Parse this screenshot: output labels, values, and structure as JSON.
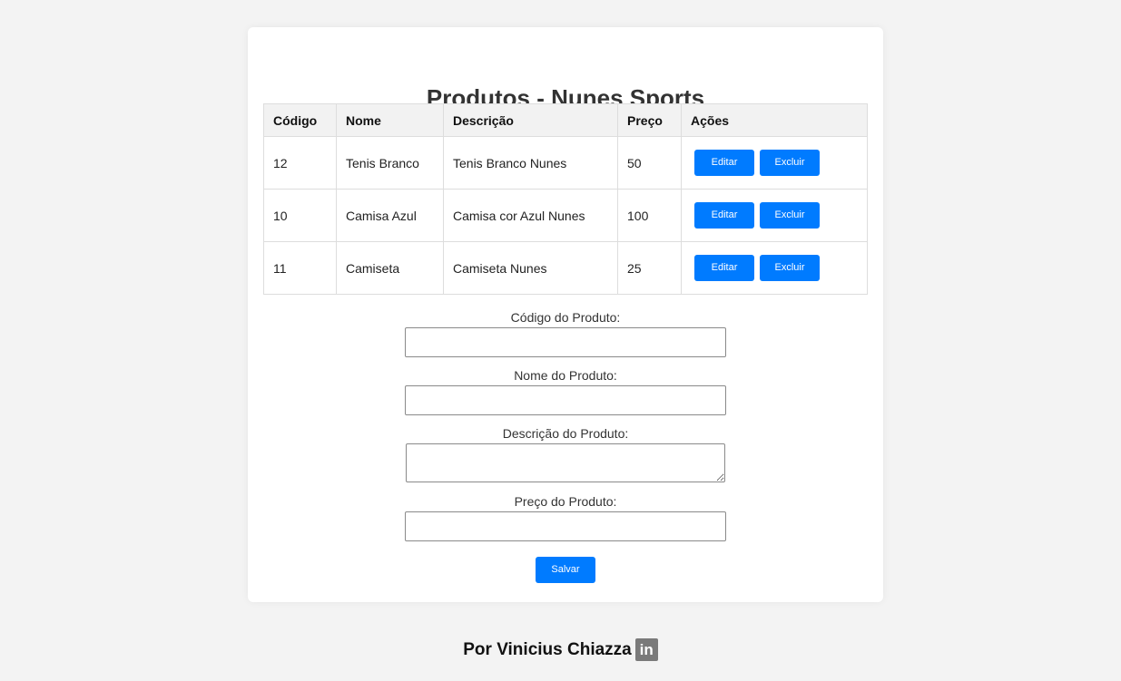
{
  "page": {
    "title": "Produtos - Nunes Sports"
  },
  "table": {
    "headers": {
      "code": "Código",
      "name": "Nome",
      "description": "Descrição",
      "price": "Preço",
      "actions": "Ações"
    },
    "rows": [
      {
        "code": "12",
        "name": "Tenis Branco",
        "description": "Tenis Branco Nunes",
        "price": "50",
        "edit": "Editar",
        "delete": "Excluir"
      },
      {
        "code": "10",
        "name": "Camisa Azul",
        "description": "Camisa cor Azul Nunes",
        "price": "100",
        "edit": "Editar",
        "delete": "Excluir"
      },
      {
        "code": "11",
        "name": "Camiseta",
        "description": "Camiseta Nunes",
        "price": "25",
        "edit": "Editar",
        "delete": "Excluir"
      }
    ]
  },
  "form": {
    "code_label": "Código do Produto:",
    "code_value": "",
    "name_label": "Nome do Produto:",
    "name_value": "",
    "description_label": "Descrição do Produto:",
    "description_value": "",
    "price_label": "Preço do Produto:",
    "price_value": "",
    "save_label": "Salvar"
  },
  "footer": {
    "text": "Por Vinicius Chiazza",
    "icon": "linkedin-icon",
    "icon_glyph": "in"
  },
  "colors": {
    "accent": "#007bff",
    "background": "#f3f3f3",
    "card": "#ffffff"
  }
}
